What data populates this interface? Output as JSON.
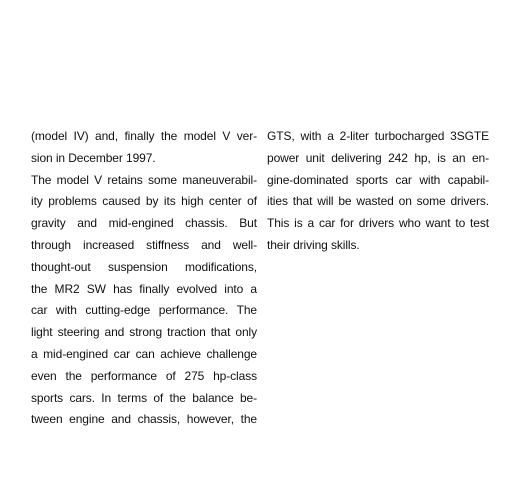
{
  "left_column": {
    "lines": [
      "(model IV) and, finally the model V ver-",
      "sion in December 1997.",
      "The model V retains some maneuverabil-",
      "ity problems caused by its high center of",
      "gravity and mid-engined chassis. But",
      "through increased stiffness and well-",
      "thought-out suspension modifications,",
      "the MR2 SW has finally evolved into a",
      "car with cutting-edge performance. The",
      "light steering and strong traction that only",
      "a mid-engined car can achieve challenge",
      "even the performance of 275 hp-class",
      "sports cars. In terms of the balance be-",
      "tween engine and chassis, however, the"
    ]
  },
  "right_column": {
    "lines": [
      "GTS, with a 2-liter turbocharged 3SGTE",
      "power unit delivering 242 hp, is an en-",
      "gine-dominated sports car with capabil-",
      "ities that will be wasted on some drivers.",
      "This is a car for drivers who want to test",
      "their driving skills."
    ]
  }
}
